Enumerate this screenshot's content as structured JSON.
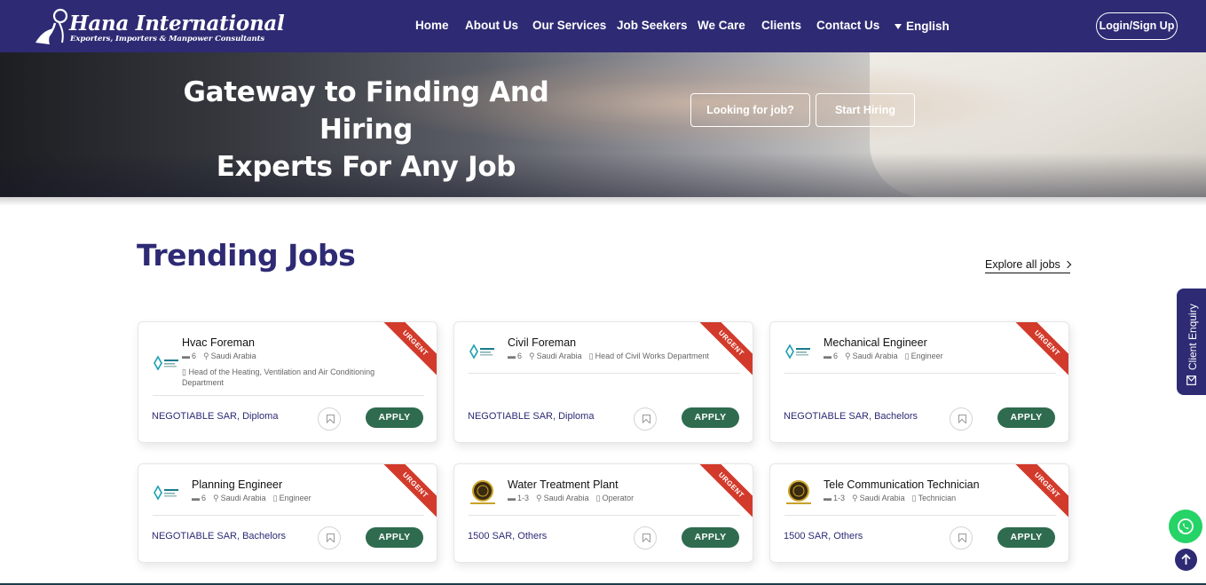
{
  "brand": {
    "name": "Hana International",
    "tagline": "Exporters, Importers & Manpower Consultants"
  },
  "nav": {
    "items": [
      "Home",
      "About Us",
      "Our Services",
      "Job Seekers",
      "We Care",
      "Clients",
      "Contact Us"
    ],
    "language": "English",
    "login_label": "Login/Sign Up"
  },
  "hero": {
    "title_line1": "Gateway to Finding And Hiring",
    "title_line2": "Experts For Any Job",
    "btn_looking": "Looking for job?",
    "btn_hiring": "Start Hiring"
  },
  "section": {
    "title": "Trending Jobs",
    "explore_label": "Explore all jobs"
  },
  "jobs": [
    {
      "title": "Hvac Foreman",
      "openings": "6",
      "location": "Saudi Arabia",
      "department": "Head of the Heating, Ventilation and Air Conditioning Department",
      "salary": "NEGOTIABLE SAR, Diploma",
      "badge": "URGENT",
      "apply": "APPLY"
    },
    {
      "title": "Civil Foreman",
      "openings": "6",
      "location": "Saudi Arabia",
      "department": "Head of Civil Works Department",
      "salary": "NEGOTIABLE SAR, Diploma",
      "badge": "URGENT",
      "apply": "APPLY"
    },
    {
      "title": "Mechanical Engineer",
      "openings": "6",
      "location": "Saudi Arabia",
      "department": "Engineer",
      "salary": "NEGOTIABLE SAR, Bachelors",
      "badge": "URGENT",
      "apply": "APPLY"
    },
    {
      "title": "Planning Engineer",
      "openings": "6",
      "location": "Saudi Arabia",
      "department": "Engineer",
      "salary": "NEGOTIABLE SAR, Bachelors",
      "badge": "URGENT",
      "apply": "APPLY"
    },
    {
      "title": "Water Treatment Plant",
      "openings": "1-3",
      "location": "Saudi Arabia",
      "department": "Operator",
      "salary": "1500 SAR, Others",
      "badge": "URGENT",
      "apply": "APPLY"
    },
    {
      "title": "Tele Communication Technician",
      "openings": "1-3",
      "location": "Saudi Arabia",
      "department": "Technician",
      "salary": "1500 SAR, Others",
      "badge": "URGENT",
      "apply": "APPLY"
    }
  ],
  "widgets": {
    "enquiry_label": "Client Enquiry"
  },
  "colors": {
    "brand_navy": "#2e2a74",
    "apply_green": "#2f6b4f",
    "urgent_red": "#d23a2b",
    "whatsapp_green": "#25d366"
  }
}
